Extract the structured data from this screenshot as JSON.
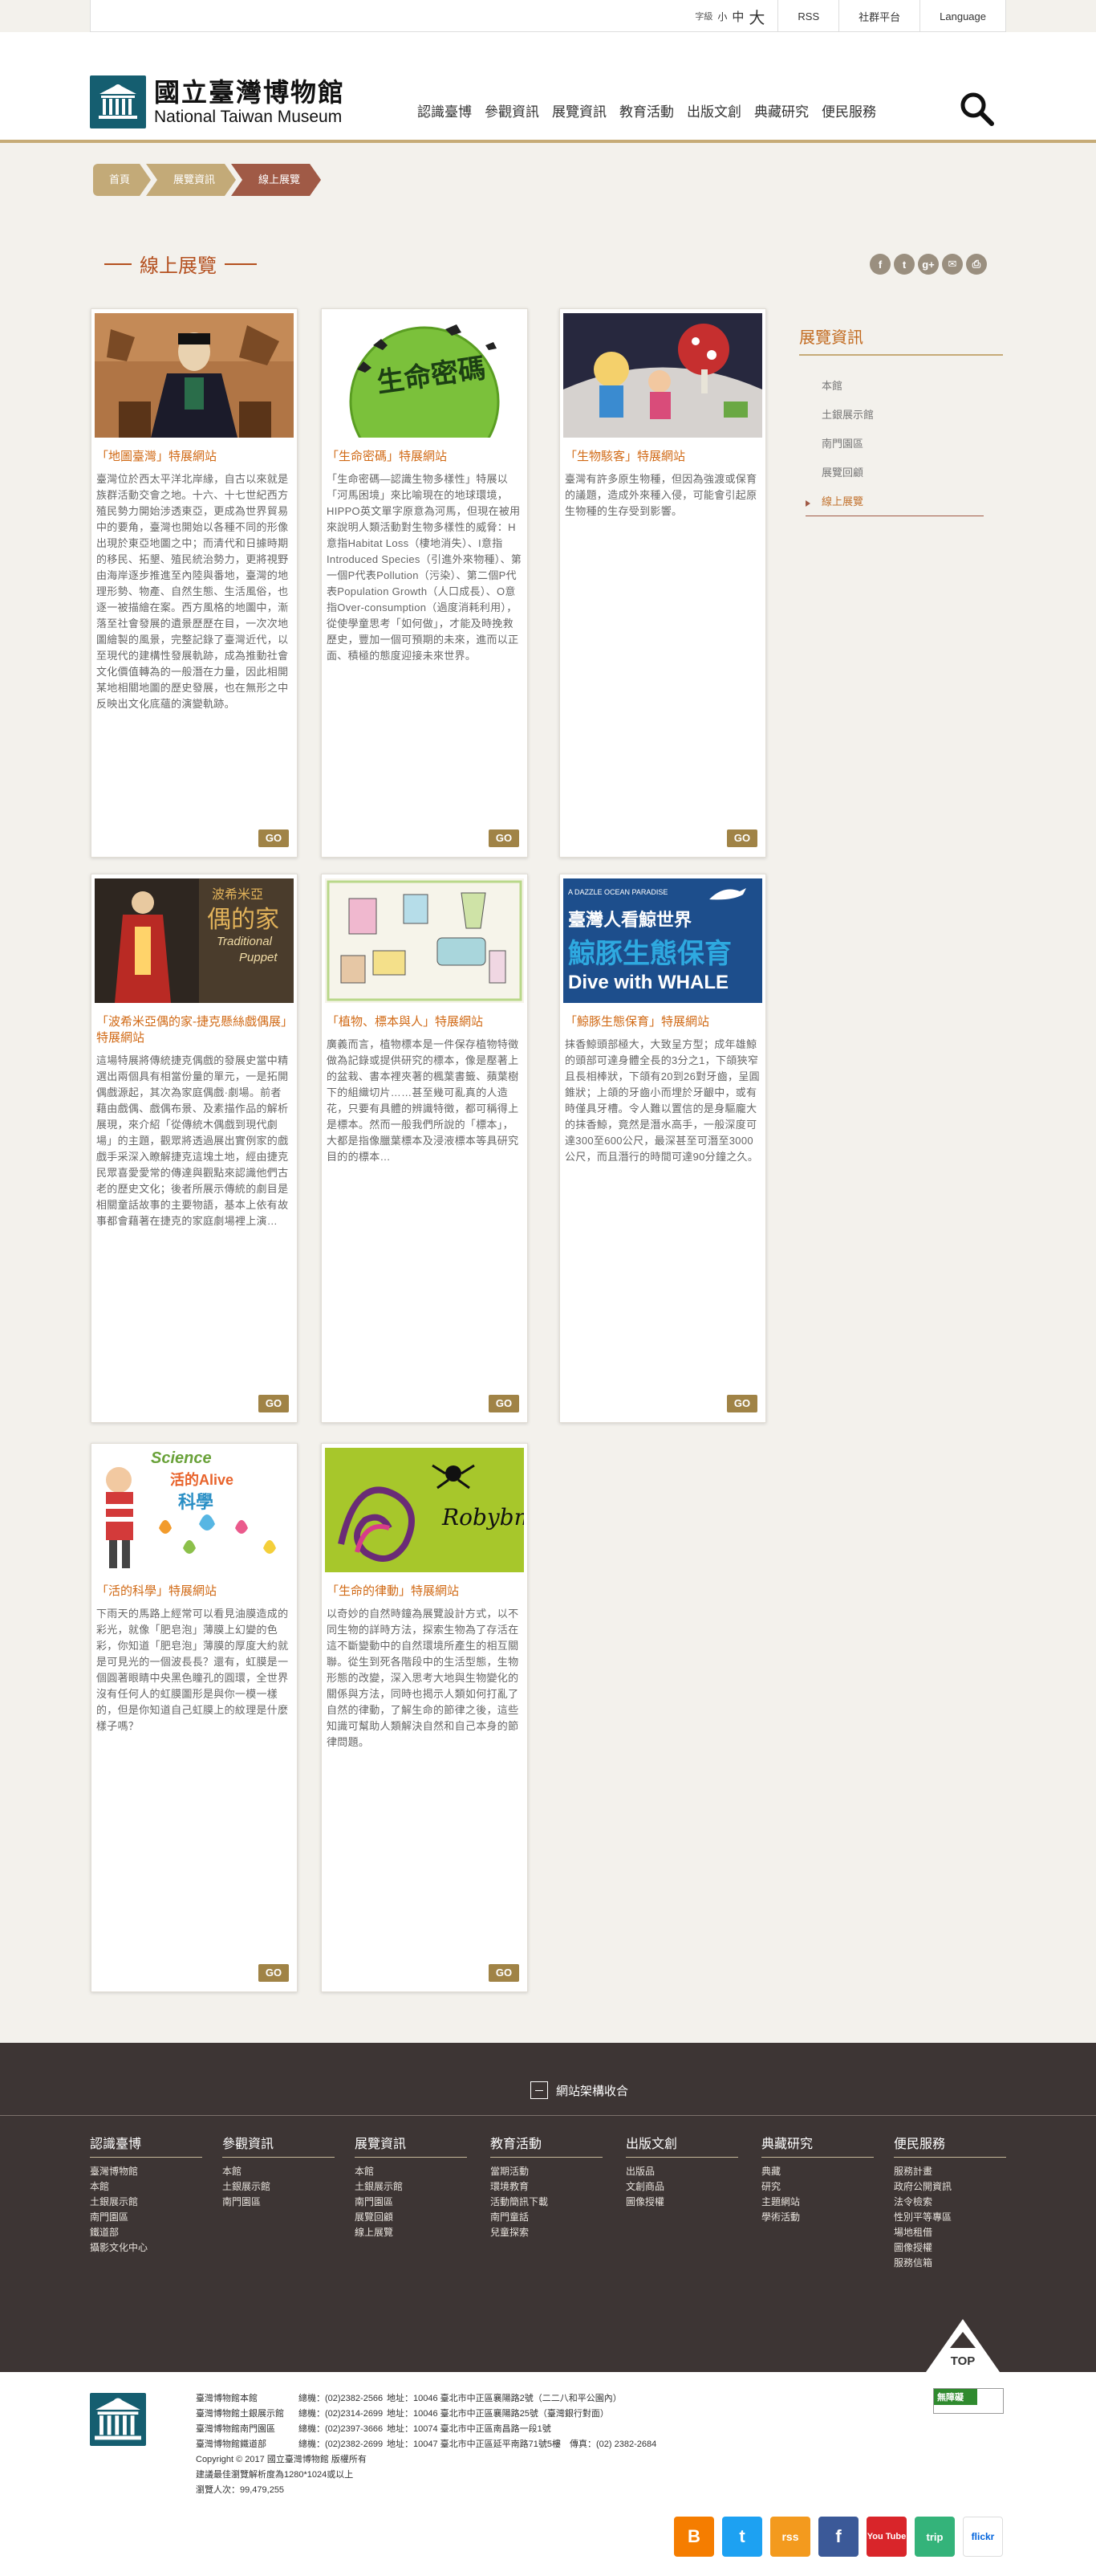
{
  "util": {
    "font_label": "字級",
    "font_small": "小",
    "font_medium": "中",
    "font_large": "大",
    "rss": "RSS",
    "community": "社群平台",
    "language": "Language"
  },
  "logo": {
    "zh": "國立臺灣博物館",
    "en": "National Taiwan Museum"
  },
  "nav": [
    "認識臺博",
    "參觀資訊",
    "展覽資訊",
    "教育活動",
    "出版文創",
    "典藏研究",
    "便民服務"
  ],
  "breadcrumb": [
    "首頁",
    "展覽資訊",
    "線上展覽"
  ],
  "page_title": "線上展覽",
  "share": [
    "f",
    "t",
    "g+",
    "✉",
    "⎙"
  ],
  "sidebar": {
    "title": "展覽資訊",
    "items": [
      "本館",
      "土銀展示館",
      "南門園區",
      "展覽回顧",
      "線上展覽"
    ]
  },
  "cards": [
    {
      "title": "「地圖臺灣」特展網站",
      "desc": "臺灣位於西太平洋北岸緣，自古以來就是族群活動交會之地。十六、十七世紀西方殖民勢力開始涉透東亞，更成為世界貿易中的要角，臺灣也開始以各種不同的形像出現於東亞地圖之中；而清代和日據時期的移民、拓墾、殖民統治勢力，更將視野由海岸逐步推進至內陸與番地，臺灣的地理形勢、物產、自然生態、生活風俗，也逐一被描繪在案。西方風格的地圖中，漸落至社會發展的遺景歷歷在目，一次次地圖繪製的風景，完整記錄了臺灣近代，以至現代的建構性發展軌跡，成為推動社會文化價值轉為的一般潛在力量，因此相開某地相關地圖的歷史發展，也在無形之中反映出文化底蘊的演變軌跡。",
      "go": "GO"
    },
    {
      "title": "「生命密碼」特展網站",
      "desc": "「生命密碼—認識生物多樣性」特展以「河馬困境」來比喻現在的地球環境，HIPPO英文單字原意為河馬，但現在被用來說明人類活動對生物多樣性的威脅：H意指Habitat Loss（棲地消失）、I意指Introduced Species（引進外來物種）、第一個P代表Pollution（污染）、第二個P代表Population Growth（人口成長）、O意指Over-consumption（過度消耗利用），從使學童思考「如何做」，才能及時挽救歷史，豐加一個可預期的未來，進而以正面、積極的態度迎接未來世界。",
      "go": "GO"
    },
    {
      "title": "「生物駭客」特展網站",
      "desc": "臺灣有許多原生物種，但因為強渡或保育的議題，造成外來種入侵，可能會引起原生物種的生存受到影響。",
      "go": "GO"
    },
    {
      "title": "「波希米亞偶的家-捷克懸絲戲偶展」特展網站",
      "desc": "這場特展將傳統捷克偶戲的發展史當中精選出兩個具有相當份量的單元，一是拓開偶戲源起，其次為家庭偶戲·劇場。前者藉由戲偶、戲偶布景、及素描作品的解析展現，來介紹「從傳統木偶戲到現代劇場」的主題，觀眾將透過展出實例家的戲戲手采深入瞭解捷克這塊土地，經由捷克民眾喜愛愛常的傳達與觀點來認識他們古老的歷史文化；後者所展示傳統的劇目是相關童話故事的主要物語，基本上依有故事都會藉著在捷克的家庭劇場裡上演…",
      "go": "GO"
    },
    {
      "title": "「植物、標本與人」特展網站",
      "desc": "廣義而言，植物標本是一件保存植物特徵做為記錄或提供研究的標本，像是壓著上的盆栽、書本裡夾著的楓葉書籤、蘋葉樹下的組織切片……甚至幾可亂真的人造花，只要有具體的辨識特徵，都可稱得上是標本。然而一般我們所說的「標本」，大都是指像臘葉標本及浸液標本等具研究目的的標本…",
      "go": "GO"
    },
    {
      "title": "「鯨豚生態保育」特展網站",
      "desc": "抹香鯨頭部極大，大致呈方型；成年雄鯨的頭部可達身體全長的3分之1，下頜狹窄且長相棒狀，下頜有20到26對牙齒，呈圓錐狀；上頜的牙齒小而埋於牙齦中，或有時僅具牙槽。令人難以置信的是身驅龐大的抹香鯨，竟然是潛水高手，一般深度可達300至600公尺，最深甚至可潛至3000公尺，而且潛行的時間可達90分鐘之久。",
      "go": "GO"
    },
    {
      "title": "「活的科學」特展網站",
      "desc": "下雨天的馬路上經常可以看見油膜造成的彩光，就像「肥皂泡」薄膜上幻變的色彩，你知道「肥皂泡」薄膜的厚度大約就是可見光的一個波長長？還有，虹膜是一個圓著眼睛中央黑色瞳孔的圓環，全世界沒有任何人的虹膜圖形是與你一模一樣的，但是你知道自己虹膜上的紋理是什麼樣子嗎？",
      "go": "GO"
    },
    {
      "title": "「生命的律動」特展網站",
      "desc": "以奇妙的自然時鐘為展覽設計方式，以不同生物的詳時方法，探索生物為了存活在這不斷變動中的自然環境所產生的相互關聯。從生到死各階段中的生活型態，生物形態的改變，深入思考大地與生物變化的關係與方法，同時也揭示人類如何打亂了自然的律動，了解生命的節律之後，這些知識可幫助人類解決自然和自己本身的節律問題。",
      "go": "GO"
    }
  ],
  "thumb_text": {
    "card2": "生命密碼",
    "card4_a": "波希米亞",
    "card4_b": "偶的家",
    "card4_c": "Traditional",
    "card4_d": "Puppet",
    "card6_a": "A DAZZLE OCEAN PARADISE",
    "card6_b": "臺灣人看鯨世界",
    "card6_c": "鯨豚生態保育",
    "card6_d": "Dive with WHALE",
    "card7_a": "Science",
    "card7_b": "活的Alive",
    "card7_c": "科學",
    "card8": "Robybm"
  },
  "sitemap": {
    "toggle": "網站架構收合",
    "columns": [
      {
        "h": "認識臺博",
        "items": [
          "臺灣博物館",
          "本館",
          "土銀展示館",
          "南門園區",
          "鐵道部",
          "攝影文化中心"
        ]
      },
      {
        "h": "參觀資訊",
        "items": [
          "本館",
          "土銀展示館",
          "南門園區"
        ]
      },
      {
        "h": "展覽資訊",
        "items": [
          "本館",
          "土銀展示館",
          "南門園區",
          "展覽回顧",
          "線上展覽"
        ]
      },
      {
        "h": "教育活動",
        "items": [
          "當期活動",
          "環境教育",
          "活動簡訊下載",
          "南門童話",
          "兒童探索"
        ]
      },
      {
        "h": "出版文創",
        "items": [
          "出版品",
          "文創商品",
          "圖像授權"
        ]
      },
      {
        "h": "典藏研究",
        "items": [
          "典藏",
          "研究",
          "主題網站",
          "學術活動"
        ]
      },
      {
        "h": "便民服務",
        "items": [
          "服務計畫",
          "政府公開資訊",
          "法令檢索",
          "性別平等專區",
          "場地租借",
          "圖像授權",
          "服務信箱"
        ]
      }
    ],
    "top": "TOP"
  },
  "footer": {
    "rows": [
      [
        "臺灣博物館本館",
        "總機：(02)2382-2566",
        "地址：10046 臺北市中正區襄陽路2號（二二八和平公園內）"
      ],
      [
        "臺灣博物館土銀展示館",
        "總機：(02)2314-2699",
        "地址：10046 臺北市中正區襄陽路25號（臺灣銀行對面）"
      ],
      [
        "臺灣博物館南門園區",
        "總機：(02)2397-3666",
        "地址：10074 臺北市中正區南昌路一段1號"
      ],
      [
        "臺灣博物館鐵道部",
        "總機：(02)2382-2699",
        "地址：10047 臺北市中正區延平南路71號5樓　傳真：(02) 2382-2684"
      ]
    ],
    "copyright": "Copyright © 2017 國立臺灣博物館 版權所有",
    "resolution": "建議最佳瀏覽解析度為1280*1024或以上",
    "visitors": "瀏覽人次：99,479,255",
    "access_label": "無障礙",
    "socials": [
      "B",
      "t",
      "rss",
      "f",
      "You Tube",
      "trip",
      "flickr"
    ]
  }
}
